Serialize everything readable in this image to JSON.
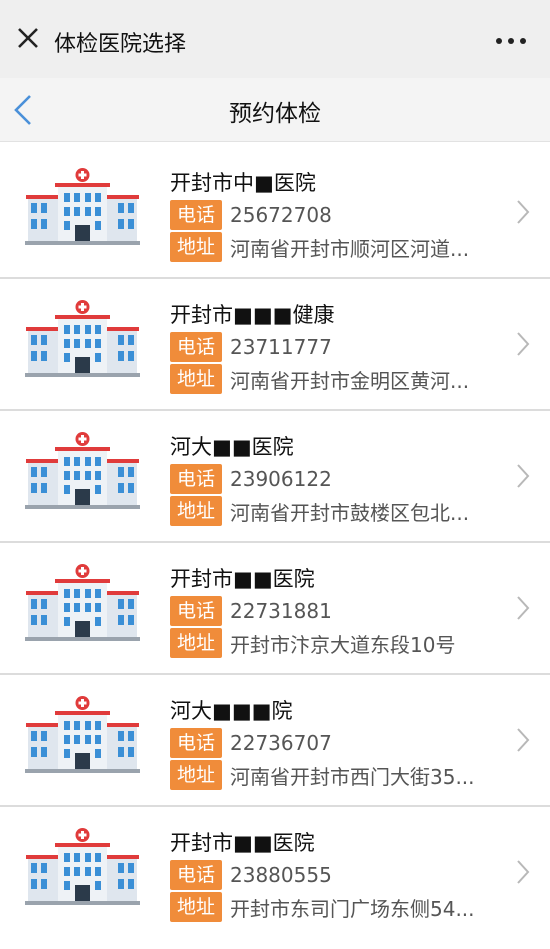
{
  "window": {
    "title": "体检医院选择",
    "close_icon": "close-icon",
    "more_icon": "more-dots-icon"
  },
  "nav": {
    "title": "预约体检",
    "back_icon": "back-chevron-icon"
  },
  "labels": {
    "phone": "电话",
    "address": "地址"
  },
  "colors": {
    "tag": "#f08c3a",
    "titlebar": "#efefef",
    "accent_back": "#4a90d9"
  },
  "hospitals": [
    {
      "name": "开封市中■医院",
      "phone": "25672708",
      "address": "河南省开封市顺河区河道..."
    },
    {
      "name": "开封市■■■健康",
      "phone": "23711777",
      "address": "河南省开封市金明区黄河..."
    },
    {
      "name": "河大■■医院",
      "phone": "23906122",
      "address": "河南省开封市鼓楼区包北..."
    },
    {
      "name": "开封市■■医院",
      "phone": "22731881",
      "address": "开封市汴京大道东段10号"
    },
    {
      "name": "河大■■■院",
      "phone": "22736707",
      "address": "河南省开封市西门大街35..."
    },
    {
      "name": "开封市■■医院",
      "phone": "23880555",
      "address": "开封市东司门广场东侧54..."
    }
  ]
}
